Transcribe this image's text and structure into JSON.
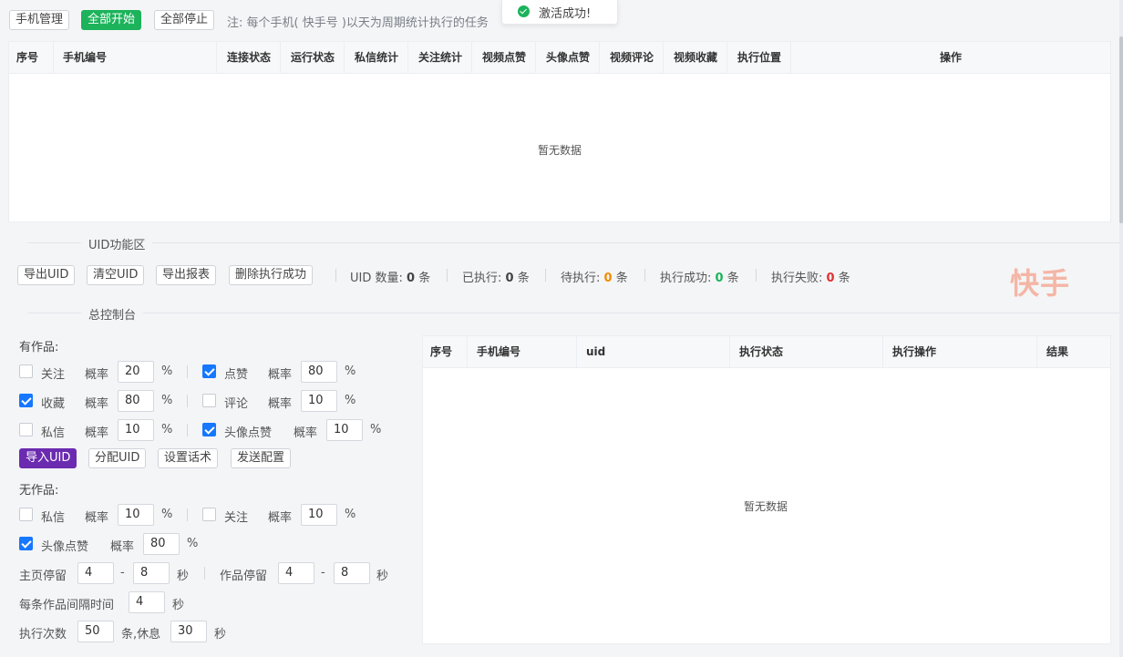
{
  "toolbar": {
    "phone_manage": "手机管理",
    "start_all": "全部开始",
    "stop_all": "全部停止",
    "note": "注: 每个手机( 快手号 )以天为周期统计执行的任务"
  },
  "toast": {
    "message": "激活成功!",
    "color": "#1cb35b"
  },
  "phone_table": {
    "columns": [
      "序号",
      "手机编号",
      "连接状态",
      "运行状态",
      "私信统计",
      "关注统计",
      "视频点赞",
      "头像点赞",
      "视频评论",
      "视频收藏",
      "执行位置",
      "操作"
    ],
    "empty_text": "暂无数据"
  },
  "uid_section": {
    "title": "UID功能区",
    "buttons": [
      "导出UID",
      "清空UID",
      "导出报表",
      "删除执行成功"
    ],
    "stats": [
      {
        "label": "UID 数量:",
        "value": "0",
        "unit": "条",
        "color": "#444444"
      },
      {
        "label": "已执行:",
        "value": "0",
        "unit": "条",
        "color": "#444444"
      },
      {
        "label": "待执行:",
        "value": "0",
        "unit": "条",
        "color": "#f08c00"
      },
      {
        "label": "执行成功:",
        "value": "0",
        "unit": "条",
        "color": "#1cb35b"
      },
      {
        "label": "执行失败:",
        "value": "0",
        "unit": "条",
        "color": "#e03131"
      }
    ],
    "brand": "快手",
    "brand_color": "#f4b6a6"
  },
  "console": {
    "title": "总控制台",
    "with_works_label": "有作品:",
    "rate_label": "概率",
    "percent": "%",
    "with_works": [
      {
        "label": "关注",
        "checked": false,
        "rate": "20"
      },
      {
        "label": "点赞",
        "checked": true,
        "rate": "80"
      },
      {
        "label": "收藏",
        "checked": true,
        "rate": "80"
      },
      {
        "label": "评论",
        "checked": false,
        "rate": "10"
      },
      {
        "label": "私信",
        "checked": false,
        "rate": "10"
      },
      {
        "label": "头像点赞",
        "checked": true,
        "rate": "10"
      }
    ],
    "buttons": [
      "导入UID",
      "分配UID",
      "设置话术",
      "发送配置"
    ],
    "no_works_label": "无作品:",
    "no_works": [
      {
        "label": "私信",
        "checked": false,
        "rate": "10"
      },
      {
        "label": "关注",
        "checked": false,
        "rate": "10"
      },
      {
        "label": "头像点赞",
        "checked": true,
        "rate": "80"
      }
    ],
    "home_stay_label": "主页停留",
    "home_stay_min": "4",
    "home_stay_max": "8",
    "work_stay_label": "作品停留",
    "work_stay_min": "4",
    "work_stay_max": "8",
    "dash": "-",
    "seconds": "秒",
    "interval_label": "每条作品间隔时间",
    "interval_value": "4",
    "exec_count_label": "执行次数",
    "exec_count": "50",
    "rest_label": "条,休息",
    "rest_value": "30"
  },
  "uid_table": {
    "columns": [
      "序号",
      "手机编号",
      "uid",
      "执行状态",
      "执行操作",
      "结果"
    ],
    "empty_text": "暂无数据"
  }
}
